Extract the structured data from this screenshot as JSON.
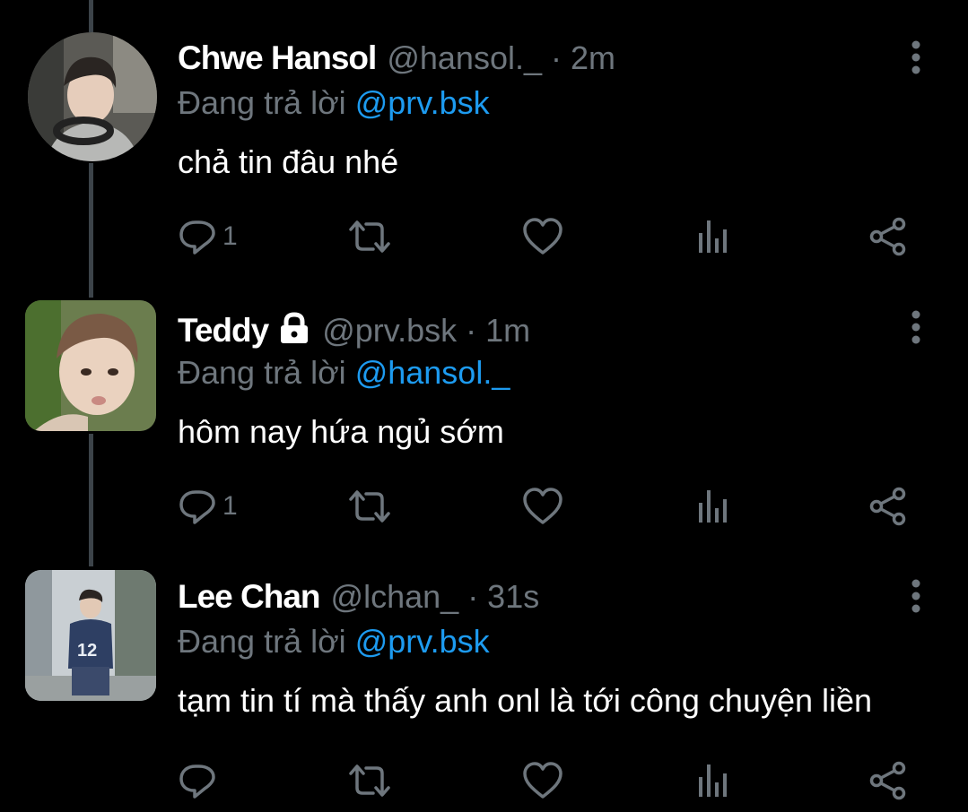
{
  "colors": {
    "background": "#000000",
    "text": "#ffffff",
    "secondary": "#6e767d",
    "mention": "#1d9bf0",
    "thread_line": "#3c4349"
  },
  "tweets": [
    {
      "name": "Chwe Hansol",
      "handle": "@hansol._",
      "time": "· 2m",
      "locked": false,
      "reply_prefix": "Đang trả lời ",
      "reply_to": "@prv.bsk",
      "text": "chả tin đâu nhé",
      "reply_count": "1",
      "icons": [
        "reply-icon",
        "retweet-icon",
        "like-icon",
        "analytics-icon",
        "share-icon",
        "more-options-icon"
      ]
    },
    {
      "name": "Teddy",
      "handle": "@prv.bsk",
      "time": "· 1m",
      "locked": true,
      "reply_prefix": "Đang trả lời ",
      "reply_to": "@hansol._",
      "text": "hôm nay hứa ngủ sớm",
      "reply_count": "1",
      "icons": [
        "reply-icon",
        "retweet-icon",
        "like-icon",
        "analytics-icon",
        "share-icon",
        "more-options-icon",
        "lock-icon"
      ]
    },
    {
      "name": "Lee Chan",
      "handle": "@lchan_",
      "time": "· 31s",
      "locked": false,
      "reply_prefix": "Đang trả lời ",
      "reply_to": "@prv.bsk",
      "text": "tạm tin tí mà thấy anh onl là tới công chuyện liền",
      "reply_count": "",
      "icons": [
        "reply-icon",
        "retweet-icon",
        "like-icon",
        "analytics-icon",
        "share-icon",
        "more-options-icon"
      ]
    }
  ]
}
